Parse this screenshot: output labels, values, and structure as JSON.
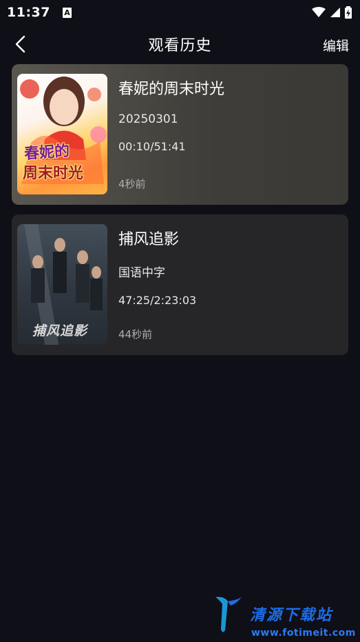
{
  "status_bar": {
    "time": "11:37",
    "notification_icon": "a-notification-icon",
    "icons": [
      "wifi-icon",
      "signal-icon",
      "battery-charging-icon"
    ]
  },
  "app_bar": {
    "back_icon": "chevron-left-icon",
    "title": "观看历史",
    "edit_label": "编辑"
  },
  "history": [
    {
      "title": "春妮的周末时光",
      "episode": "20250301",
      "progress": "00:10/51:41",
      "time_ago": "4秒前",
      "poster_title_line1": "春妮的",
      "poster_title_line2": "周末时光"
    },
    {
      "title": "捕风追影",
      "episode": "国语中字",
      "progress": "47:25/2:23:03",
      "time_ago": "44秒前",
      "poster_title": "捕风追影"
    }
  ],
  "watermark": {
    "text_cn": "清源下载站",
    "url": "www.fotimeit.com"
  },
  "colors": {
    "background": "#0f0f18",
    "card1_bg": "#4a4843",
    "card2_bg": "#262628",
    "watermark_blue": "#1e6de6"
  }
}
